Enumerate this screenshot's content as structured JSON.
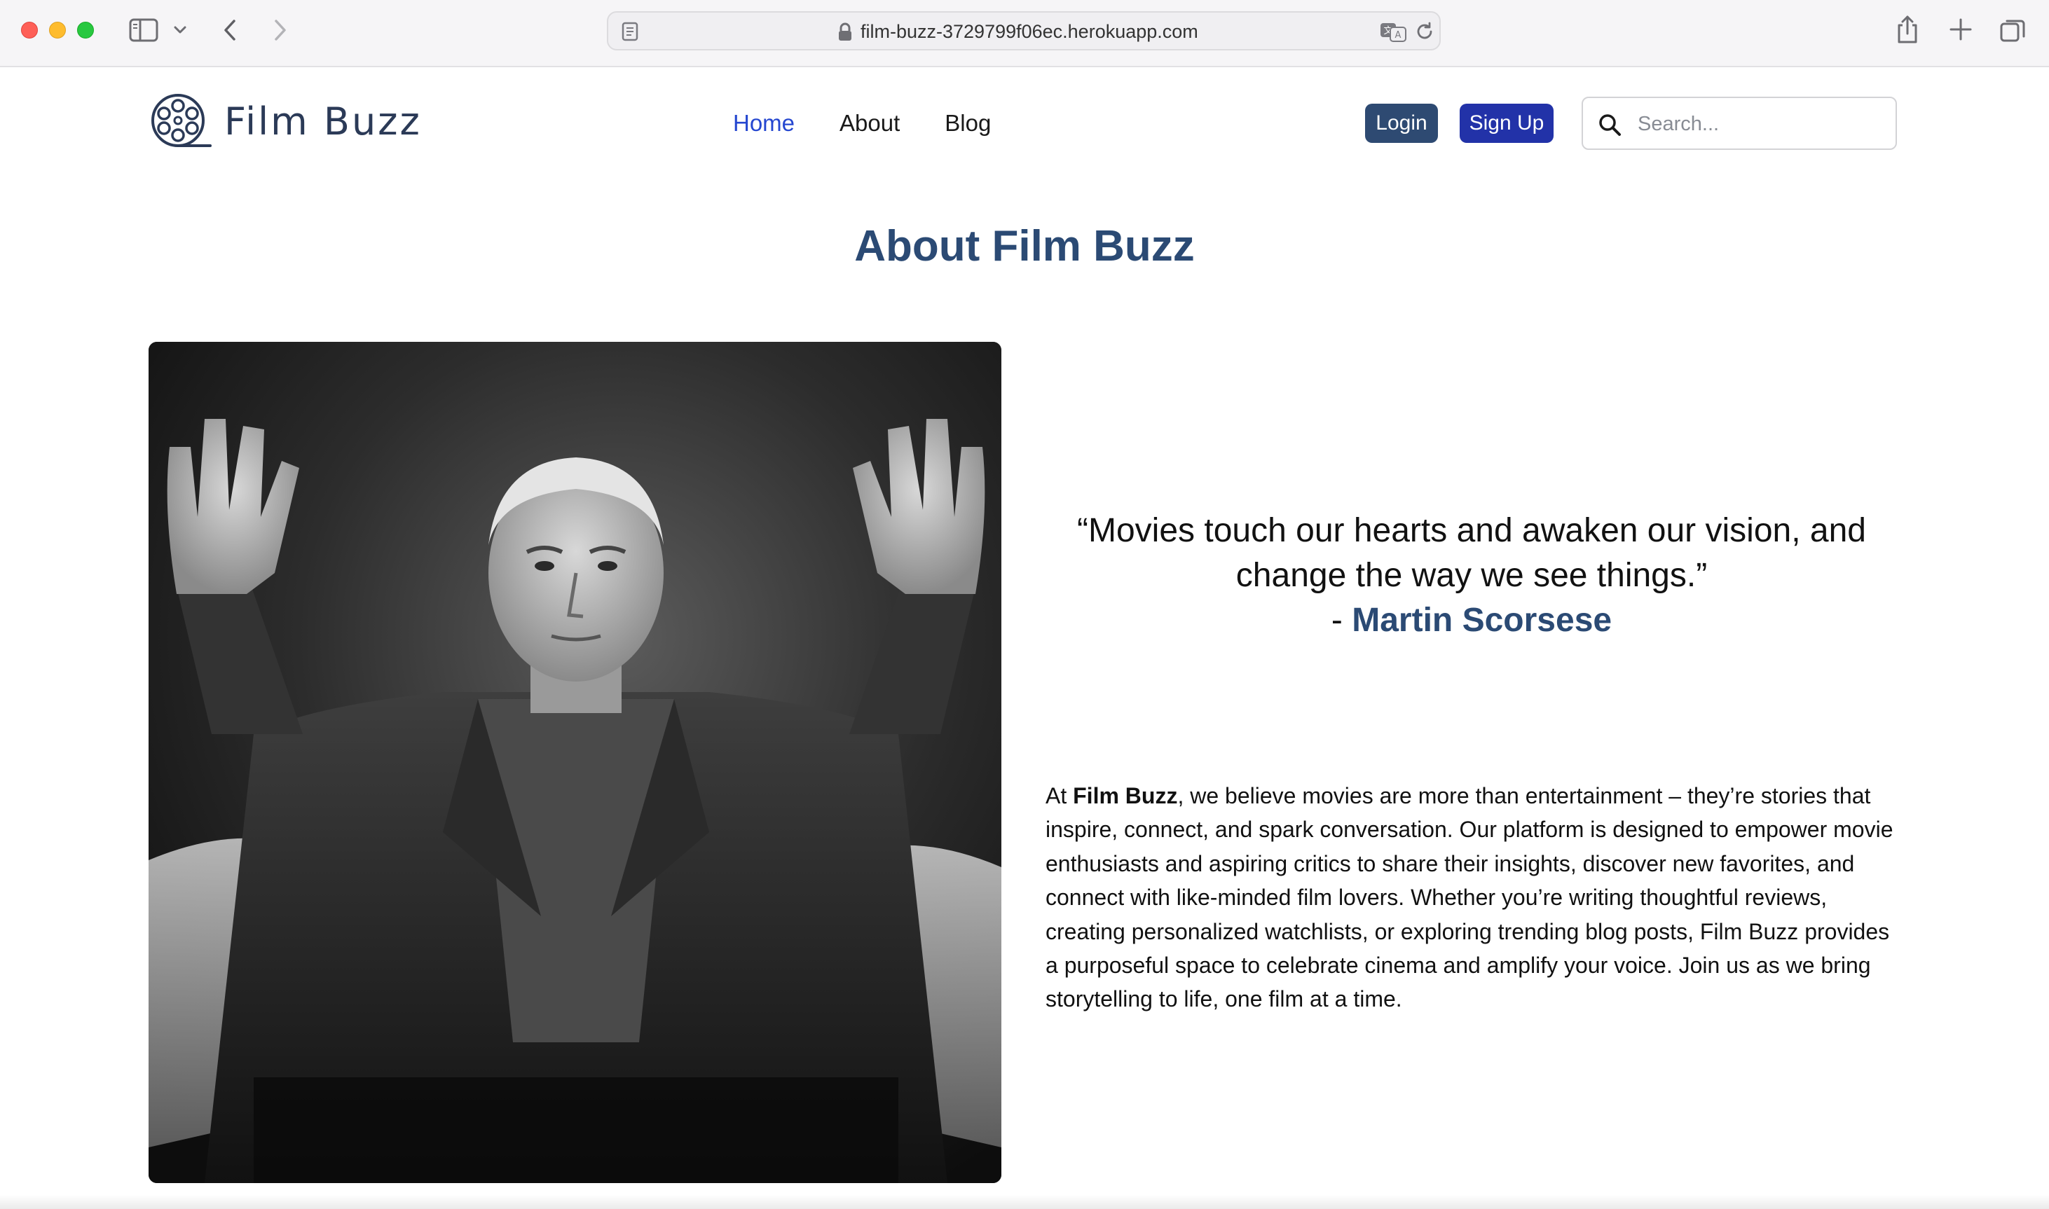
{
  "browser": {
    "url": "film-buzz-3729799f06ec.herokuapp.com",
    "icons": [
      "sidebar-icon",
      "chevron-down-icon",
      "back-icon",
      "forward-icon",
      "page-icon",
      "lock-icon",
      "translate-icon",
      "reload-icon",
      "share-icon",
      "plus-icon",
      "tabs-icon"
    ]
  },
  "header": {
    "brand": "Film Buzz",
    "nav": {
      "home": "Home",
      "about": "About",
      "blog": "Blog"
    },
    "login_label": "Login",
    "signup_label": "Sign Up",
    "search_placeholder": "Search..."
  },
  "colors": {
    "brand_navy": "#2b4a74",
    "active_link": "#2547d0",
    "login_button": "#2e4a72",
    "signup_button": "#2232a8"
  },
  "main": {
    "title": "About Film Buzz",
    "quote": {
      "text": "“Movies touch our hearts and awaken our vision, and change the way we see things.”",
      "author_prefix": "- ",
      "author": "Martin Scorsese"
    },
    "about": {
      "intro": "At ",
      "brand": "Film Buzz",
      "body": ", we believe movies are more than entertainment – they’re stories that inspire, connect, and spark conversation. Our platform is designed to empower movie enthusiasts and aspiring critics to share their insights, discover new favorites, and connect with like-minded film lovers. Whether you’re writing thoughtful reviews, creating personalized watchlists, or exploring trending blog posts, Film Buzz provides a purposeful space to celebrate cinema and amplify your voice. Join us as we bring storytelling to life, one film at a time."
    }
  }
}
